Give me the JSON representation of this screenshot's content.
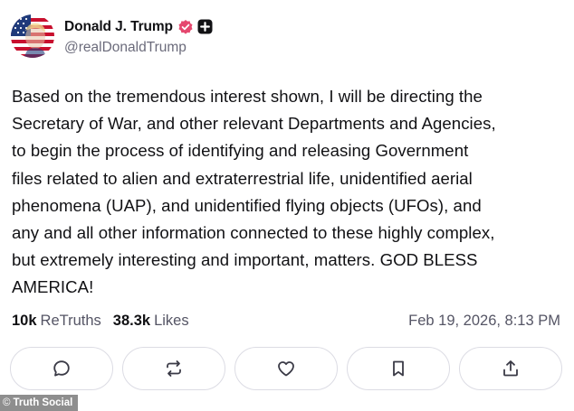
{
  "author": {
    "display_name": "Donald J. Trump",
    "handle": "@realDonaldTrump",
    "avatar_icon": "american-flag-portrait",
    "verified_icon": "verified-badge-icon",
    "verified_color": "#e5486f",
    "plus_badge_icon": "plus-badge-icon"
  },
  "post": {
    "lines": [
      "Based on the tremendous interest shown, I will be directing the",
      "Secretary of War, and other relevant Departments and Agencies,",
      "to begin the process of identifying and releasing Government",
      "files related to alien and extraterrestrial life, unidentified aerial",
      "phenomena (UAP), and unidentified flying objects (UFOs), and",
      "any and all other information connected to these highly complex,",
      "but extremely interesting and important, matters. GOD BLESS",
      "AMERICA!"
    ]
  },
  "stats": {
    "retruths_count": "10k",
    "retruths_label": "ReTruths",
    "likes_count": "38.3k",
    "likes_label": "Likes",
    "timestamp": "Feb 19, 2026, 8:13 PM"
  },
  "actions": [
    {
      "icon": "reply-icon"
    },
    {
      "icon": "retruth-icon"
    },
    {
      "icon": "like-heart-icon"
    },
    {
      "icon": "bookmark-icon"
    },
    {
      "icon": "share-icon"
    }
  ],
  "watermark": {
    "copyright": "©",
    "text": "Truth Social"
  },
  "colors": {
    "text": "#111114",
    "muted": "#555565",
    "handle": "#6b6b7b",
    "border": "#dcdce4",
    "watermark_bg": "#8e8e8e"
  }
}
